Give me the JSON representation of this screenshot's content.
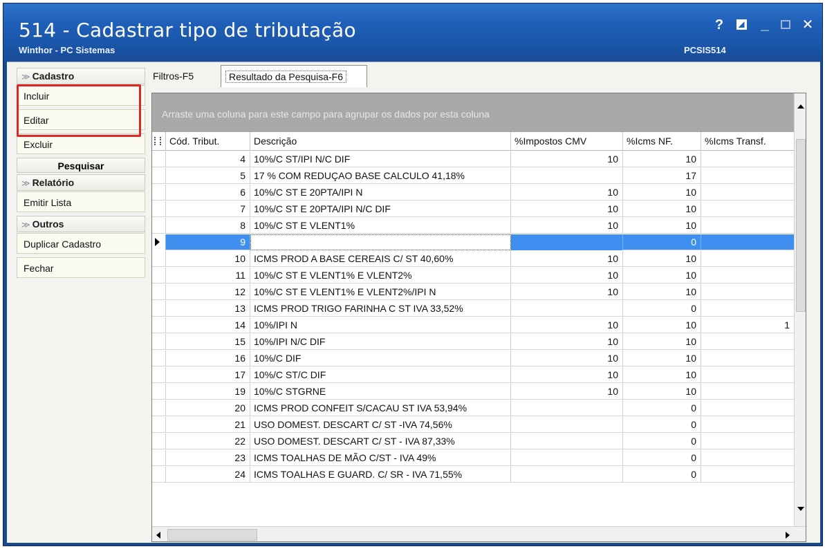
{
  "window": {
    "title": "514 - Cadastrar tipo de tributação",
    "subtitle": "Winthor - PC Sistemas",
    "code": "PCSIS514",
    "help_glyph": "?",
    "min_glyph": "_",
    "close_glyph": "✕"
  },
  "sidebar": {
    "cadastro_header": "Cadastro",
    "incluir": "Incluir",
    "editar": "Editar",
    "excluir": "Excluir",
    "pesquisar_header": "Pesquisar",
    "relatorio_header": "Relatório",
    "emitir_lista": "Emitir Lista",
    "outros_header": "Outros",
    "duplicar_cadastro": "Duplicar Cadastro",
    "fechar": "Fechar",
    "chevron": "≫"
  },
  "tabs": {
    "filtros": "Filtros-F5",
    "resultado": "Resultado da Pesquisa-F6"
  },
  "grid": {
    "group_hint": "Arraste uma coluna para este campo para agrupar os dados por esta coluna",
    "columns": {
      "cod": "Cód. Tribut.",
      "desc": "Descrição",
      "cmv": "%Impostos CMV",
      "icms_nf": "%Icms NF.",
      "icms_transf": "%Icms Transf."
    },
    "rows": [
      {
        "cod": "4",
        "desc": "10%/C ST/IPI N/C DIF",
        "cmv": "10",
        "nf": "10",
        "transf": ""
      },
      {
        "cod": "5",
        "desc": "17 % COM REDUÇAO BASE CALCULO 41,18%",
        "cmv": "",
        "nf": "17",
        "transf": ""
      },
      {
        "cod": "6",
        "desc": "10%/C ST E 20PTA/IPI N",
        "cmv": "10",
        "nf": "10",
        "transf": ""
      },
      {
        "cod": "7",
        "desc": "10%/C ST E 20PTA/IPI N/C DIF",
        "cmv": "10",
        "nf": "10",
        "transf": ""
      },
      {
        "cod": "8",
        "desc": "10%/C ST E VLENT1%",
        "cmv": "10",
        "nf": "10",
        "transf": ""
      },
      {
        "cod": "9",
        "desc": "",
        "cmv": "",
        "nf": "0",
        "transf": ""
      },
      {
        "cod": "10",
        "desc": "ICMS PROD A BASE CEREAIS C/ ST 40,60%",
        "cmv": "10",
        "nf": "10",
        "transf": ""
      },
      {
        "cod": "11",
        "desc": "10%/C ST E VLENT1% E VLENT2%",
        "cmv": "10",
        "nf": "10",
        "transf": ""
      },
      {
        "cod": "12",
        "desc": "10%/C ST E VLENT1% E VLENT2%/IPI N",
        "cmv": "10",
        "nf": "10",
        "transf": ""
      },
      {
        "cod": "13",
        "desc": "ICMS PROD TRIGO FARINHA C ST IVA 33,52%",
        "cmv": "",
        "nf": "0",
        "transf": ""
      },
      {
        "cod": "14",
        "desc": "10%/IPI N",
        "cmv": "10",
        "nf": "10",
        "transf": "1"
      },
      {
        "cod": "15",
        "desc": "10%/IPI N/C DIF",
        "cmv": "10",
        "nf": "10",
        "transf": ""
      },
      {
        "cod": "16",
        "desc": "10%/C DIF",
        "cmv": "10",
        "nf": "10",
        "transf": ""
      },
      {
        "cod": "17",
        "desc": "10%/C ST/C DIF",
        "cmv": "10",
        "nf": "10",
        "transf": ""
      },
      {
        "cod": "19",
        "desc": "10%/C STGRNE",
        "cmv": "10",
        "nf": "10",
        "transf": ""
      },
      {
        "cod": "20",
        "desc": "ICMS PROD CONFEIT S/CACAU ST IVA 53,94%",
        "cmv": "",
        "nf": "0",
        "transf": ""
      },
      {
        "cod": "21",
        "desc": "USO DOMEST. DESCART C/ ST -IVA 74,56%",
        "cmv": "",
        "nf": "0",
        "transf": ""
      },
      {
        "cod": "22",
        "desc": "USO DOMEST. DESCART  C/ ST - IVA 87,33%",
        "cmv": "",
        "nf": "0",
        "transf": ""
      },
      {
        "cod": "23",
        "desc": "ICMS TOALHAS DE MÃO C/ST - IVA 49%",
        "cmv": "",
        "nf": "0",
        "transf": ""
      },
      {
        "cod": "24",
        "desc": "ICMS TOALHAS E GUARD. C/ SR - IVA 71,55%",
        "cmv": "",
        "nf": "0",
        "transf": ""
      }
    ],
    "selected_row_index": 5
  }
}
